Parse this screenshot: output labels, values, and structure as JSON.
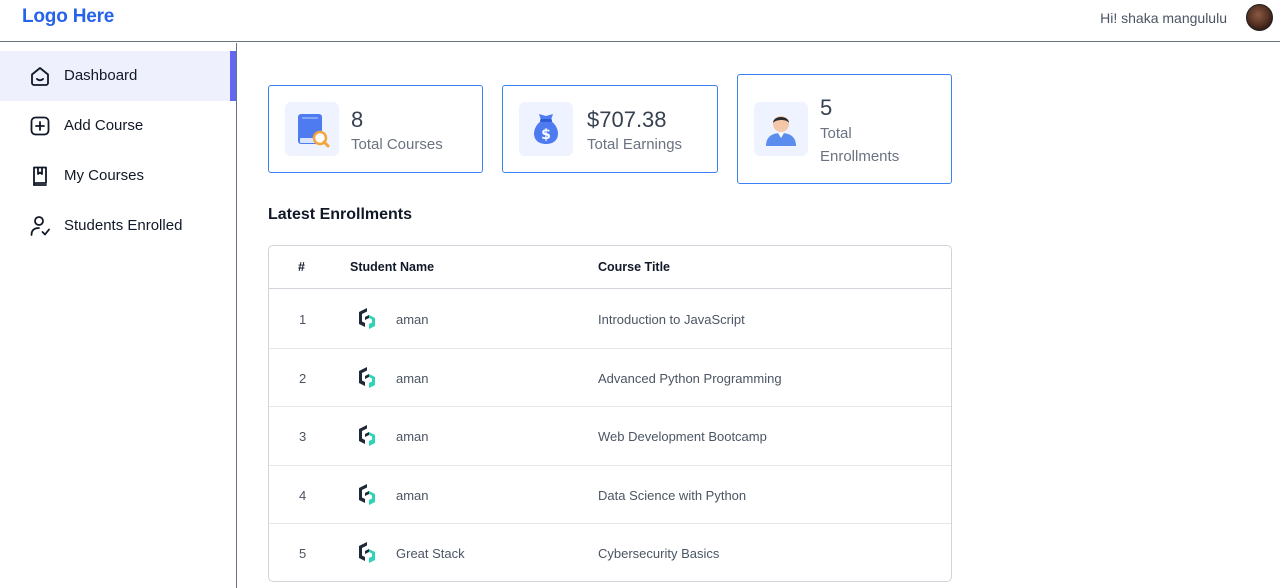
{
  "header": {
    "logo": "Logo Here",
    "greeting": "Hi! shaka mangululu"
  },
  "sidebar": {
    "items": [
      {
        "label": "Dashboard",
        "icon": "home-icon",
        "active": true
      },
      {
        "label": "Add Course",
        "icon": "add-square-icon",
        "active": false
      },
      {
        "label": "My Courses",
        "icon": "bookmark-book-icon",
        "active": false
      },
      {
        "label": "Students Enrolled",
        "icon": "person-check-icon",
        "active": false
      }
    ]
  },
  "stats": [
    {
      "value": "8",
      "label": "Total Courses",
      "icon": "book-icon"
    },
    {
      "value": "$707.38",
      "label": "Total Earnings",
      "icon": "money-bag-icon"
    },
    {
      "value": "5",
      "label_line1": "Total",
      "label_line2": "Enrollments",
      "icon": "student-icon"
    }
  ],
  "enrollments": {
    "title": "Latest Enrollments",
    "columns": [
      "#",
      "Student Name",
      "Course Title"
    ],
    "rows": [
      {
        "num": "1",
        "student": "aman",
        "course": "Introduction to JavaScript"
      },
      {
        "num": "2",
        "student": "aman",
        "course": "Advanced Python Programming"
      },
      {
        "num": "3",
        "student": "aman",
        "course": "Web Development Bootcamp"
      },
      {
        "num": "4",
        "student": "aman",
        "course": "Data Science with Python"
      },
      {
        "num": "5",
        "student": "Great Stack",
        "course": "Cybersecurity Basics"
      }
    ]
  },
  "colors": {
    "brand": "#2563eb",
    "active_accent": "#6366f1",
    "card_border": "#3b82f6"
  }
}
